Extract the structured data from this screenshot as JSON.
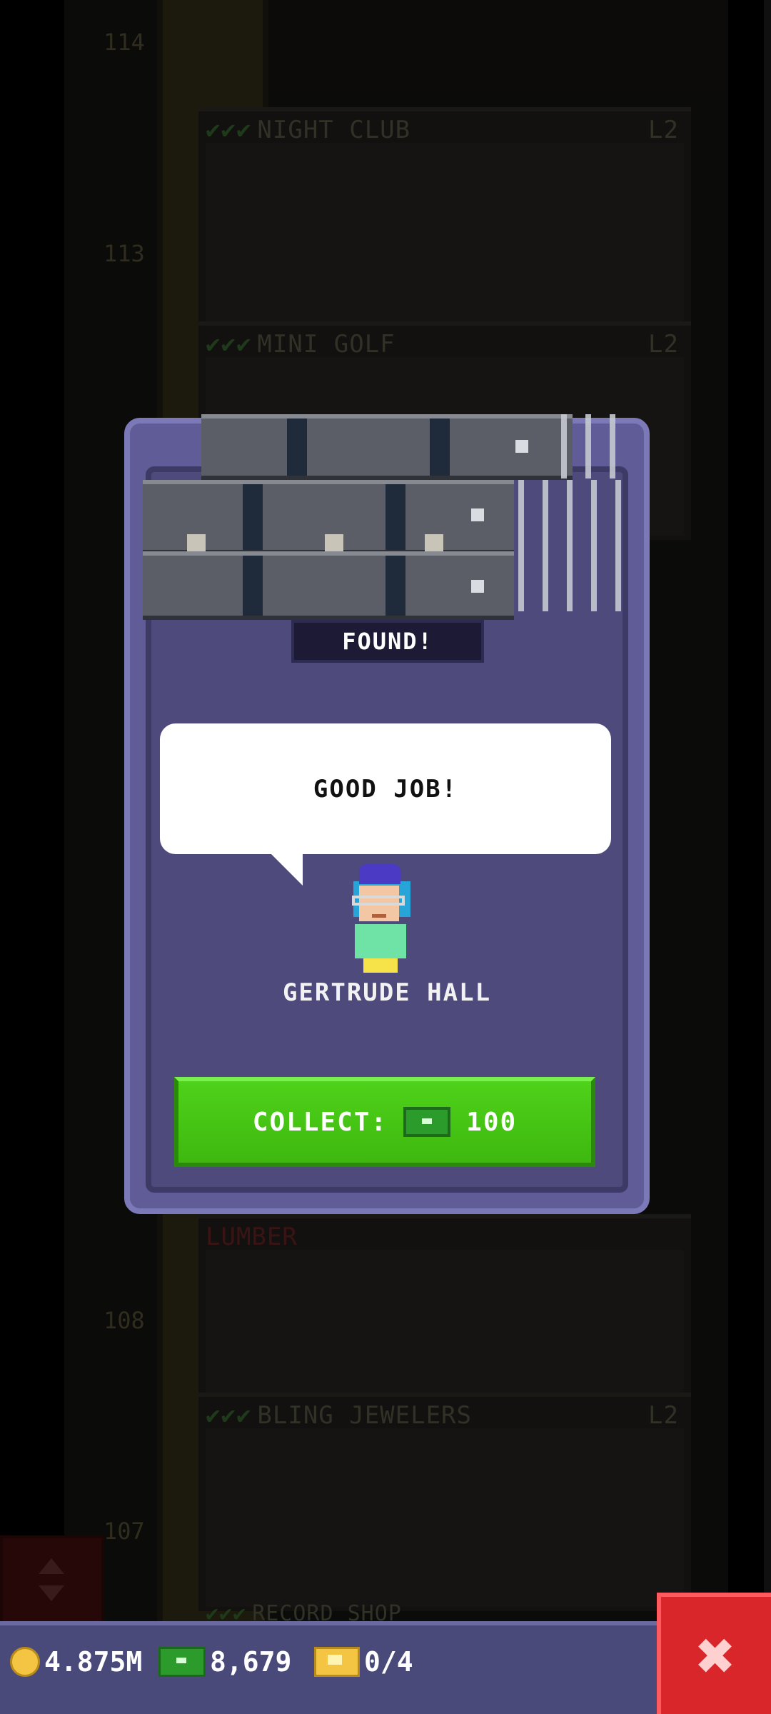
{
  "background": {
    "floors": [
      {
        "number": "114",
        "name": "NIGHT CLUB",
        "level": "L2"
      },
      {
        "number": "113",
        "name": "MINI GOLF",
        "level": "L2"
      },
      {
        "number": "108",
        "name": "BLING JEWELERS",
        "level": "L2"
      },
      {
        "number": "107",
        "name": "RECORD SHOP",
        "level": ""
      }
    ],
    "floor_checks": "✔✔✔",
    "partial_sign": "LUMBER"
  },
  "dialog": {
    "status_label": "FOUND!",
    "speech": "GOOD JOB!",
    "character_name": "GERTRUDE HALL",
    "collect_label": "COLLECT:",
    "collect_amount": "100"
  },
  "bottom_bar": {
    "coins": "4.875M",
    "bux": "8,679",
    "tickets": "0/4",
    "close_glyph": "✖"
  },
  "icons": {
    "coin": "coin-icon",
    "bux": "bux-icon",
    "ticket": "ticket-icon",
    "close": "close-icon",
    "elevator": "elevator-arrows-icon"
  },
  "colors": {
    "dialog_bg": "#5f5c98",
    "button_green": "#4fd21a",
    "close_red": "#d9262b",
    "bottom_bar": "#4a4a7a"
  }
}
